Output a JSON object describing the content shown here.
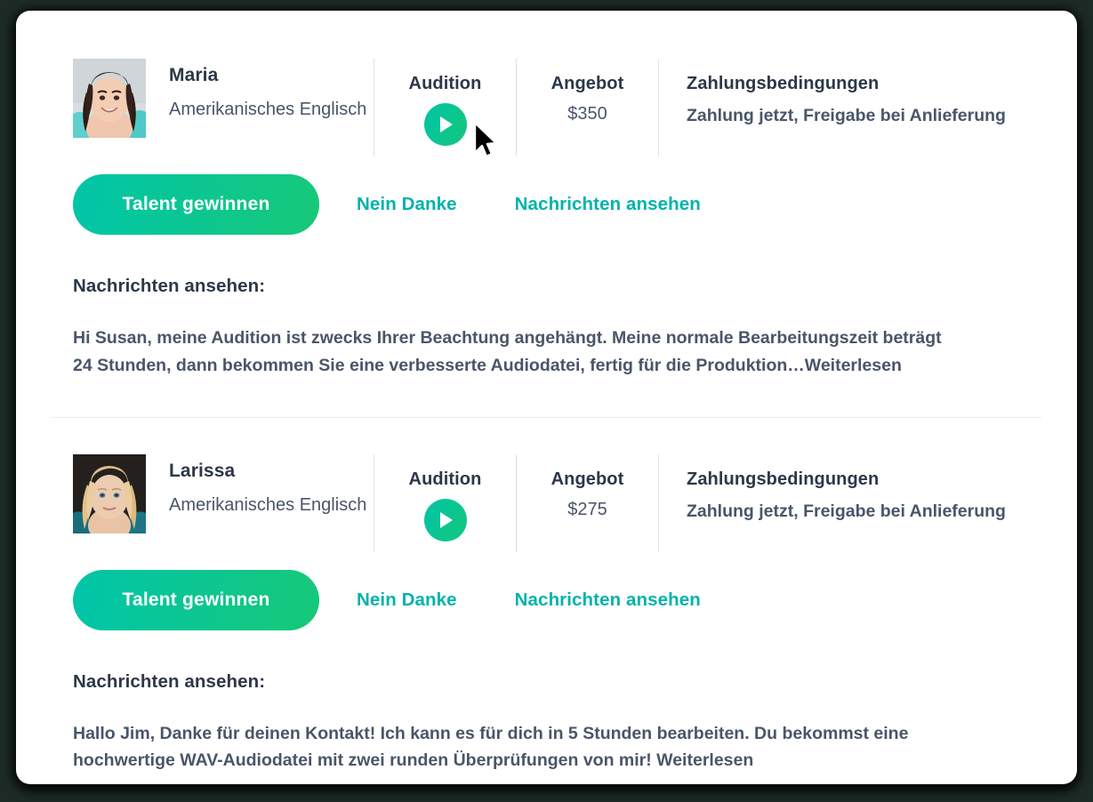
{
  "theme": {
    "accent_green_start": "#00c5a9",
    "accent_green_end": "#17c878",
    "link_teal": "#00b3ab",
    "heading_color": "#2d3748",
    "body_color": "#4a5568",
    "card_background": "#ffffff",
    "page_background": "#1d2b26",
    "divider_color": "#eceded"
  },
  "labels": {
    "audition": "Audition",
    "offer": "Angebot",
    "payment_terms": "Zahlungsbedingungen",
    "win_talent": "Talent gewinnen",
    "decline": "Nein Danke",
    "view_messages": "Nachrichten ansehen",
    "messages_label": "Nachrichten ansehen:",
    "play_icon": "play-icon",
    "cursor_icon": "mouse-cursor-arrow"
  },
  "talents": [
    {
      "name": "Maria",
      "language": "Amerikanisches Englisch",
      "avatar_name": "avatar-maria",
      "offer": "$350",
      "payment_terms_value": "Zahlung jetzt, Freigabe bei Anlieferung",
      "message": "Hi Susan, meine Audition ist zwecks Ihrer Beachtung angehängt. Meine normale Bearbeitungszeit beträgt 24 Stunden, dann bekommen Sie eine verbesserte Audiodatei, fertig für die Produktion…Weiterlesen",
      "cursor_visible": true
    },
    {
      "name": "Larissa",
      "language": "Amerikanisches Englisch",
      "avatar_name": "avatar-larissa",
      "offer": "$275",
      "payment_terms_value": "Zahlung jetzt, Freigabe bei Anlieferung",
      "message": "Hallo Jim, Danke für deinen Kontakt! Ich kann es für dich in 5 Stunden bearbeiten. Du bekommst eine hochwertige WAV-Audiodatei mit zwei runden Überprüfungen von mir! Weiterlesen",
      "cursor_visible": false
    }
  ]
}
